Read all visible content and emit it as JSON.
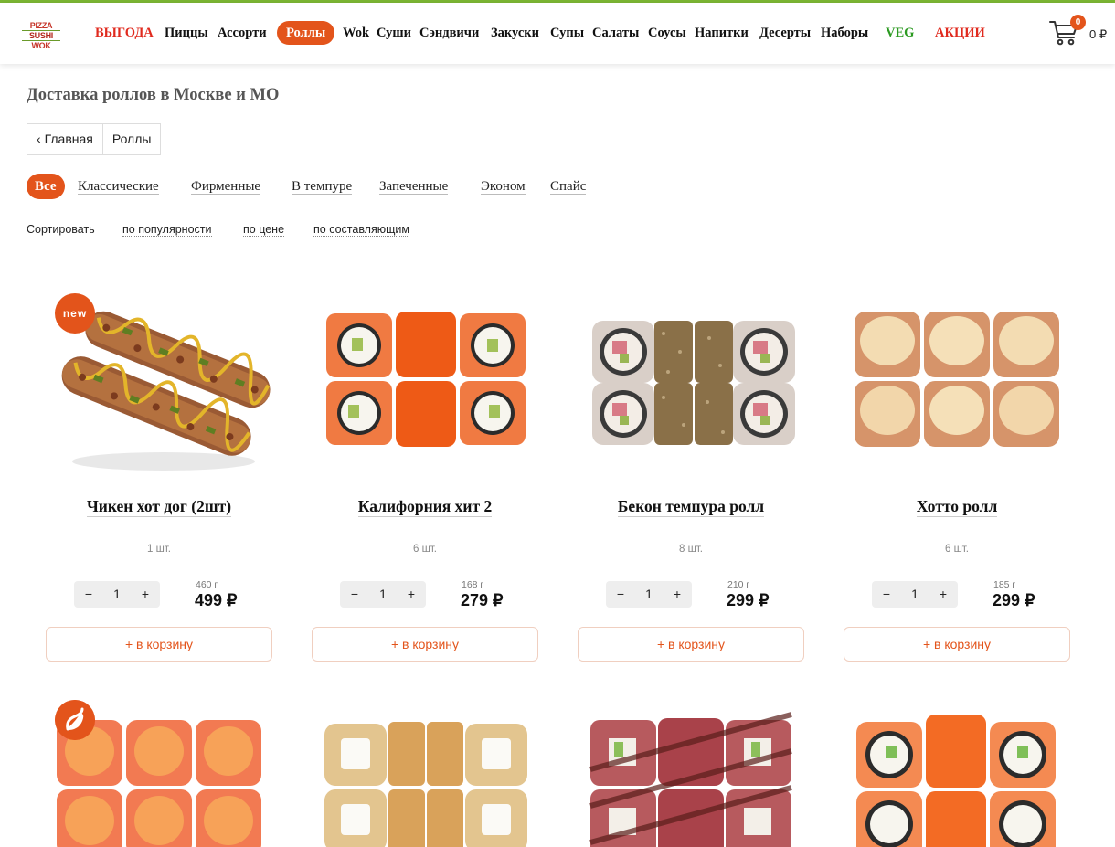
{
  "header": {
    "logo": [
      "PIZZA",
      "SUSHI",
      "WOK"
    ],
    "nav": [
      {
        "label": "ВЫГОДА",
        "style": "red"
      },
      {
        "label": "Пиццы",
        "style": ""
      },
      {
        "label": "Ассорти",
        "style": ""
      },
      {
        "label": "Роллы",
        "style": "active"
      },
      {
        "label": "Wok",
        "style": ""
      },
      {
        "label": "Суши",
        "style": ""
      },
      {
        "label": "Сэндвичи",
        "style": ""
      },
      {
        "label": "Закуски",
        "style": ""
      },
      {
        "label": "Супы",
        "style": ""
      },
      {
        "label": "Салаты",
        "style": ""
      },
      {
        "label": "Соусы",
        "style": ""
      },
      {
        "label": "Напитки",
        "style": ""
      },
      {
        "label": "Десерты",
        "style": ""
      },
      {
        "label": "Наборы",
        "style": ""
      },
      {
        "label": "VEG",
        "style": "green"
      },
      {
        "label": "АКЦИИ",
        "style": "red"
      }
    ],
    "cart_count": "0",
    "cart_total": "0 ₽"
  },
  "page_title": "Доставка роллов в Москве и МО",
  "breadcrumbs": {
    "home": "Главная",
    "current": "Роллы"
  },
  "filters": [
    "Все",
    "Классические",
    "Фирменные",
    "В темпуре",
    "Запеченные",
    "Эконом",
    "Спайс"
  ],
  "sort": {
    "label": "Сортировать",
    "options": [
      "по популярности",
      "по цене",
      "по составляющим"
    ]
  },
  "products": [
    {
      "title": "Чикен хот дог (2шт)",
      "count": "1 шт.",
      "qty": "1",
      "weight": "460 г",
      "price": "499 ₽",
      "add": "+ в корзину",
      "badge": "new",
      "image": "hotdog"
    },
    {
      "title": "Калифорния хит 2",
      "count": "6 шт.",
      "qty": "1",
      "weight": "168 г",
      "price": "279 ₽",
      "add": "+ в корзину",
      "badge": "",
      "image": "california"
    },
    {
      "title": "Бекон темпура ролл",
      "count": "8 шт.",
      "qty": "1",
      "weight": "210 г",
      "price": "299 ₽",
      "add": "+ в корзину",
      "badge": "",
      "image": "tempura"
    },
    {
      "title": "Хотто ролл",
      "count": "6 шт.",
      "qty": "1",
      "weight": "185 г",
      "price": "299 ₽",
      "add": "+ в корзину",
      "badge": "",
      "image": "baked"
    },
    {
      "badge": "hot",
      "image": "spicy"
    },
    {
      "image": "tempura-cheese"
    },
    {
      "image": "eel"
    },
    {
      "image": "salmon"
    }
  ],
  "badge_text": {
    "new": "new"
  },
  "icons": {
    "cart": "cart-icon",
    "hot": "chili-icon",
    "back": "chevron-left-icon"
  },
  "colors": {
    "accent": "#e3541b",
    "green": "#2c9a22",
    "red": "#e02a1e",
    "topbar": "#7bb533"
  }
}
